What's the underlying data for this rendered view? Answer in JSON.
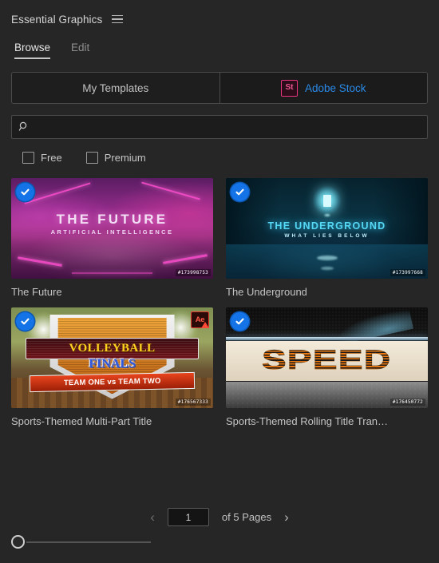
{
  "header": {
    "title": "Essential Graphics",
    "menu_icon": "hamburger-menu-icon"
  },
  "tabs": [
    {
      "label": "Browse",
      "active": true
    },
    {
      "label": "Edit",
      "active": false
    }
  ],
  "source_toggle": {
    "my_templates_label": "My Templates",
    "adobe_stock_label": "Adobe Stock",
    "stock_logo_text": "St",
    "active": "Adobe Stock",
    "accent_color": "#2a8ae8",
    "stock_logo_color": "#e8357d"
  },
  "search": {
    "value": "",
    "placeholder": "",
    "icon": "search-icon"
  },
  "filters": [
    {
      "label": "Free",
      "checked": false
    },
    {
      "label": "Premium",
      "checked": false
    }
  ],
  "results": [
    {
      "title": "The Future",
      "stock_id": "#173998753",
      "selected": true,
      "warning": false,
      "art_title": "THE FUTURE",
      "art_subtitle": "ARTIFICIAL INTELLIGENCE"
    },
    {
      "title": "The Underground",
      "stock_id": "#173997668",
      "selected": true,
      "warning": false,
      "art_title": "THE UNDERGROUND",
      "art_subtitle": "WHAT LIES BELOW"
    },
    {
      "title": "Sports-Themed Multi-Part Title",
      "stock_id": "#176567333",
      "selected": true,
      "warning": true,
      "warning_badge": "Ae",
      "art_title": "VOLLEYBALL",
      "art_subtitle": "FINALS",
      "art_ribbon": "TEAM ONE vs TEAM TWO"
    },
    {
      "title": "Sports-Themed Rolling  Title Tran…",
      "stock_id": "#176450772",
      "selected": true,
      "warning": false,
      "art_title": "SPEED"
    }
  ],
  "pagination": {
    "prev_icon": "chevron-left-icon",
    "next_icon": "chevron-right-icon",
    "current_page": "1",
    "pages_label": "of 5 Pages"
  },
  "zoom_slider": {
    "value": "0"
  }
}
